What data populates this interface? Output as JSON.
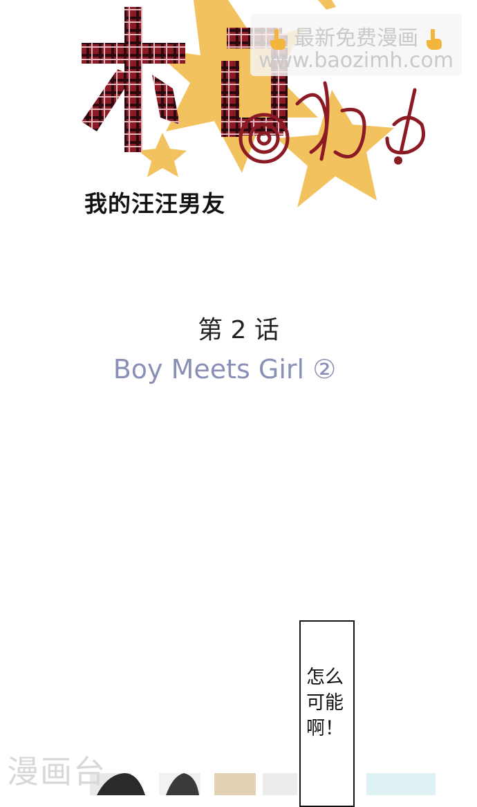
{
  "logo": {
    "label": "我的汪汪男友 title logo"
  },
  "series_subtitle": "我的汪汪男友",
  "watermark": {
    "line1": "最新免费漫画",
    "line2": "www.baozimh.com",
    "bottom_text": "漫画台"
  },
  "chapter": {
    "number_label": "第 2 话",
    "title": "Boy Meets Girl ②"
  },
  "speech_bubble": {
    "text": "怎么\n可能\n啊！"
  },
  "colors": {
    "plaid_red": "#8b1a24",
    "star_yellow": "#f2c25e",
    "title_lavender": "#8a8fb5"
  }
}
